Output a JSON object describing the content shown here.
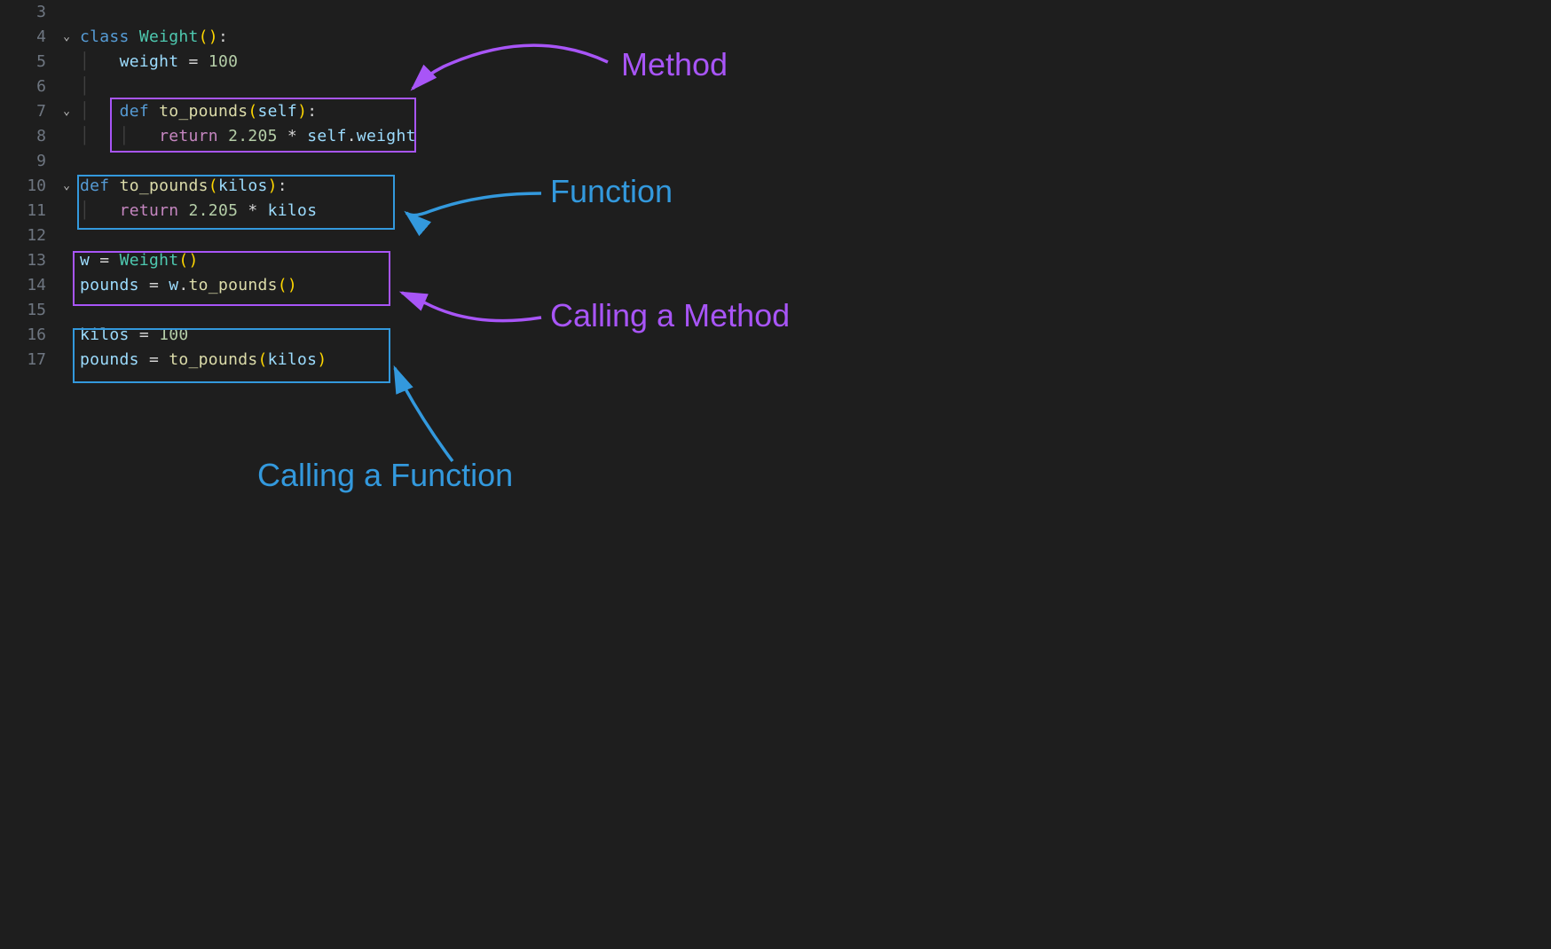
{
  "lines": {
    "3": "3",
    "4": "4",
    "5": "5",
    "6": "6",
    "7": "7",
    "8": "8",
    "9": "9",
    "10": "10",
    "11": "11",
    "12": "12",
    "13": "13",
    "14": "14",
    "15": "15",
    "16": "16",
    "17": "17"
  },
  "code": {
    "kw_class": "class",
    "cls_weight": "Weight",
    "var_weight": "weight",
    "eq": " = ",
    "n100": "100",
    "kw_def": "def",
    "fn_to_pounds": "to_pounds",
    "param_self": "self",
    "kw_return": "return",
    "n2205": "2.205",
    "star": " * ",
    "self_dot": "self",
    "dot": ".",
    "param_kilos": "kilos",
    "var_w": "w",
    "var_pounds": "pounds",
    "var_kilos": "kilos",
    "w_dot": "w",
    "lp": "(",
    "rp": ")",
    "colon": ":"
  },
  "annotations": {
    "method": "Method",
    "function": "Function",
    "calling_method": "Calling a Method",
    "calling_function": "Calling a Function"
  }
}
